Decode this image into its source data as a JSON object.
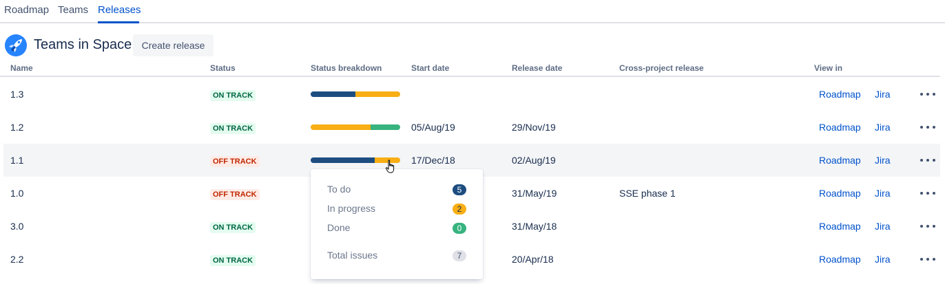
{
  "tabs": [
    "Roadmap",
    "Teams",
    "Releases"
  ],
  "active_tab": "Releases",
  "project": {
    "name": "Teams in Space"
  },
  "create_button": "Create release",
  "columns": [
    "Name",
    "Status",
    "Status breakdown",
    "Start date",
    "Release date",
    "Cross-project release",
    "View in"
  ],
  "colors": {
    "todo": "#1d4d80",
    "in_progress": "#f8ae14",
    "done": "#36b37e",
    "link": "#0052cc"
  },
  "rows": [
    {
      "name": "1.3",
      "status": "ON TRACK",
      "status_type": "on",
      "breakdown": {
        "todo": 1,
        "in_progress": 1,
        "done": 0
      },
      "start": "",
      "release": "",
      "cross": "",
      "view_roadmap": "Roadmap",
      "view_jira": "Jira"
    },
    {
      "name": "1.2",
      "status": "ON TRACK",
      "status_type": "on",
      "breakdown": {
        "todo": 0,
        "in_progress": 2,
        "done": 1
      },
      "start": "05/Aug/19",
      "release": "29/Nov/19",
      "cross": "",
      "view_roadmap": "Roadmap",
      "view_jira": "Jira"
    },
    {
      "name": "1.1",
      "status": "OFF TRACK",
      "status_type": "off",
      "breakdown": {
        "todo": 5,
        "in_progress": 2,
        "done": 0
      },
      "start": "17/Dec/18",
      "release": "02/Aug/19",
      "cross": "",
      "view_roadmap": "Roadmap",
      "view_jira": "Jira"
    },
    {
      "name": "1.0",
      "status": "OFF TRACK",
      "status_type": "off",
      "breakdown": null,
      "start": "",
      "release": "31/May/19",
      "cross": "SSE phase 1",
      "view_roadmap": "Roadmap",
      "view_jira": "Jira"
    },
    {
      "name": "3.0",
      "status": "ON TRACK",
      "status_type": "on",
      "breakdown": null,
      "start": "",
      "release": "31/May/18",
      "cross": "",
      "view_roadmap": "Roadmap",
      "view_jira": "Jira"
    },
    {
      "name": "2.2",
      "status": "ON TRACK",
      "status_type": "on",
      "breakdown": null,
      "start": "",
      "release": "20/Apr/18",
      "cross": "",
      "view_roadmap": "Roadmap",
      "view_jira": "Jira"
    }
  ],
  "popup": {
    "items": [
      {
        "label": "To do",
        "count": "5",
        "color": "#1d4d80",
        "text_color": "#ffffff"
      },
      {
        "label": "In progress",
        "count": "2",
        "color": "#f8ae14",
        "text_color": "#172b4d"
      },
      {
        "label": "Done",
        "count": "0",
        "color": "#36b37e",
        "text_color": "#ffffff"
      }
    ],
    "total_label": "Total issues",
    "total": "7"
  }
}
